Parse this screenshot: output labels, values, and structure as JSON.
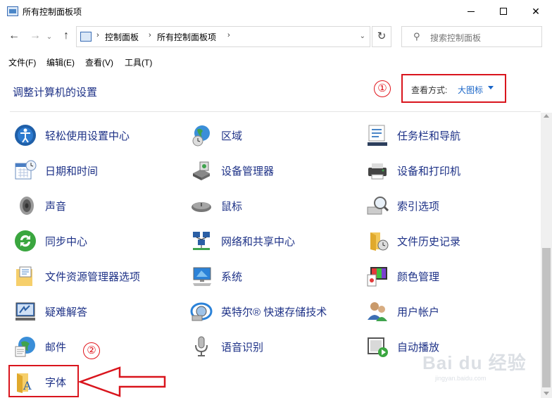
{
  "window": {
    "title": "所有控制面板项"
  },
  "navigation": {
    "breadcrumbs": [
      "控制面板",
      "所有控制面板项"
    ],
    "search_placeholder": "搜索控制面板"
  },
  "menu": [
    "文件(F)",
    "编辑(E)",
    "查看(V)",
    "工具(T)"
  ],
  "header": {
    "title": "调整计算机的设置",
    "view_label": "查看方式:",
    "view_value": "大图标"
  },
  "annotations": {
    "marker_1": "①",
    "marker_2": "②"
  },
  "items": [
    {
      "label": "轻松使用设置中心",
      "icon": "ease-of-access-icon"
    },
    {
      "label": "区域",
      "icon": "region-globe-icon"
    },
    {
      "label": "任务栏和导航",
      "icon": "taskbar-icon"
    },
    {
      "label": "日期和时间",
      "icon": "calendar-clock-icon"
    },
    {
      "label": "设备管理器",
      "icon": "device-manager-icon"
    },
    {
      "label": "设备和打印机",
      "icon": "printer-icon"
    },
    {
      "label": "声音",
      "icon": "speaker-icon"
    },
    {
      "label": "鼠标",
      "icon": "mouse-icon"
    },
    {
      "label": "索引选项",
      "icon": "indexing-icon"
    },
    {
      "label": "同步中心",
      "icon": "sync-icon"
    },
    {
      "label": "网络和共享中心",
      "icon": "network-icon"
    },
    {
      "label": "文件历史记录",
      "icon": "file-history-icon"
    },
    {
      "label": "文件资源管理器选项",
      "icon": "folder-options-icon"
    },
    {
      "label": "系统",
      "icon": "system-monitor-icon"
    },
    {
      "label": "颜色管理",
      "icon": "color-management-icon"
    },
    {
      "label": "疑难解答",
      "icon": "troubleshooting-icon"
    },
    {
      "label": "英特尔® 快速存储技术",
      "icon": "intel-rst-icon"
    },
    {
      "label": "用户帐户",
      "icon": "user-accounts-icon"
    },
    {
      "label": "邮件",
      "icon": "mail-icon"
    },
    {
      "label": "语音识别",
      "icon": "microphone-icon"
    },
    {
      "label": "自动播放",
      "icon": "autoplay-icon"
    },
    {
      "label": "字体",
      "icon": "fonts-icon"
    }
  ],
  "watermark": {
    "brand": "Bai du 经验",
    "url": "jingyan.baidu.com"
  },
  "colors": {
    "link": "#1e3287",
    "annotation_red": "#d9151d",
    "accent_blue": "#1a66c8"
  }
}
